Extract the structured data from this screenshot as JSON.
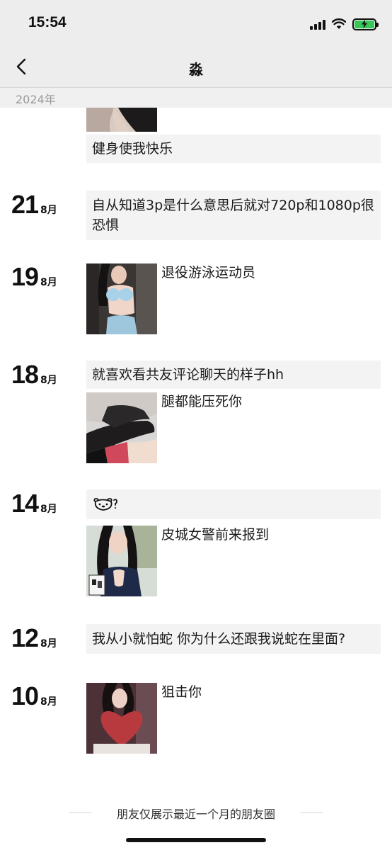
{
  "status_bar": {
    "time": "15:54"
  },
  "nav": {
    "title": "淼",
    "back_icon": "chevron-left-icon"
  },
  "year_header": "2024年",
  "colors": {
    "battery_fill": "#38c659",
    "bar_bg": "#ededed",
    "text_bg": "#f3f3f3"
  },
  "top_post": {
    "caption": "健身使我快乐"
  },
  "posts": [
    {
      "day": "21",
      "month": "8月",
      "text": "自从知道3p是什么意思后就对720p和1080p很恐惧"
    },
    {
      "day": "19",
      "month": "8月",
      "caption": "退役游泳运动员"
    },
    {
      "day": "18",
      "month": "8月",
      "text": "就喜欢看共友评论聊天的样子hh",
      "caption": "腿都能压死你"
    },
    {
      "day": "14",
      "month": "8月",
      "emoji": "bear-face-emoji",
      "caption": "皮城女警前来报到"
    },
    {
      "day": "12",
      "month": "8月",
      "text": "我从小就怕蛇 你为什么还跟我说蛇在里面?"
    },
    {
      "day": "10",
      "month": "8月",
      "caption": "狙击你"
    }
  ],
  "footer": {
    "text": "朋友仅展示最近一个月的朋友圈"
  }
}
